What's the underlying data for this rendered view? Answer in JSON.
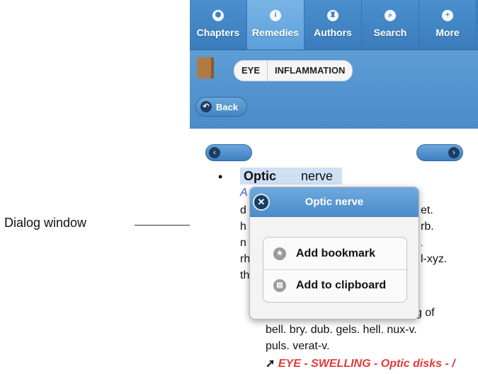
{
  "annotation": {
    "label": "Dialog window"
  },
  "tabs": [
    {
      "label": "Chapters",
      "icon": "book-icon",
      "glyph": "⬢"
    },
    {
      "label": "Remedies",
      "icon": "info-icon",
      "glyph": "i"
    },
    {
      "label": "Authors",
      "icon": "authors-icon",
      "glyph": "♜"
    },
    {
      "label": "Search",
      "icon": "search-icon",
      "glyph": "⌕"
    },
    {
      "label": "More",
      "icon": "plus-icon",
      "glyph": "+"
    }
  ],
  "active_tab": "Remedies",
  "breadcrumb": [
    "EYE",
    "INFLAMMATION"
  ],
  "back_label": "Back",
  "content": {
    "term_word": "Optic",
    "term_rest": "nerve",
    "line1_start": "A",
    "line2_start": "d",
    "line2_end": "et.",
    "line3_start": "h",
    "line3_end": "rb.",
    "line4_start": "n",
    "line4_end": ".",
    "line5_start": "rh",
    "line5_end": "l-xyz.",
    "line6_start": "th",
    "line7_partial": "ng of",
    "line8": "bell. bry. dub. gels. hell. nux-v.",
    "line9": "puls. verat-v.",
    "link_text": "EYE - SWELLING - Optic disks - /"
  },
  "dialog": {
    "title": "Optic nerve",
    "items": [
      {
        "label": "Add bookmark",
        "icon": "star-icon"
      },
      {
        "label": "Add to clipboard",
        "icon": "clipboard-icon"
      }
    ]
  },
  "colors": {
    "tabbar": "#3f82c1",
    "tab_active": "#6aa8e0",
    "header": "#5496d0",
    "highlight": "#cfe0f5",
    "link_red": "#e23a3a",
    "text_blue": "#3a5bd6"
  }
}
